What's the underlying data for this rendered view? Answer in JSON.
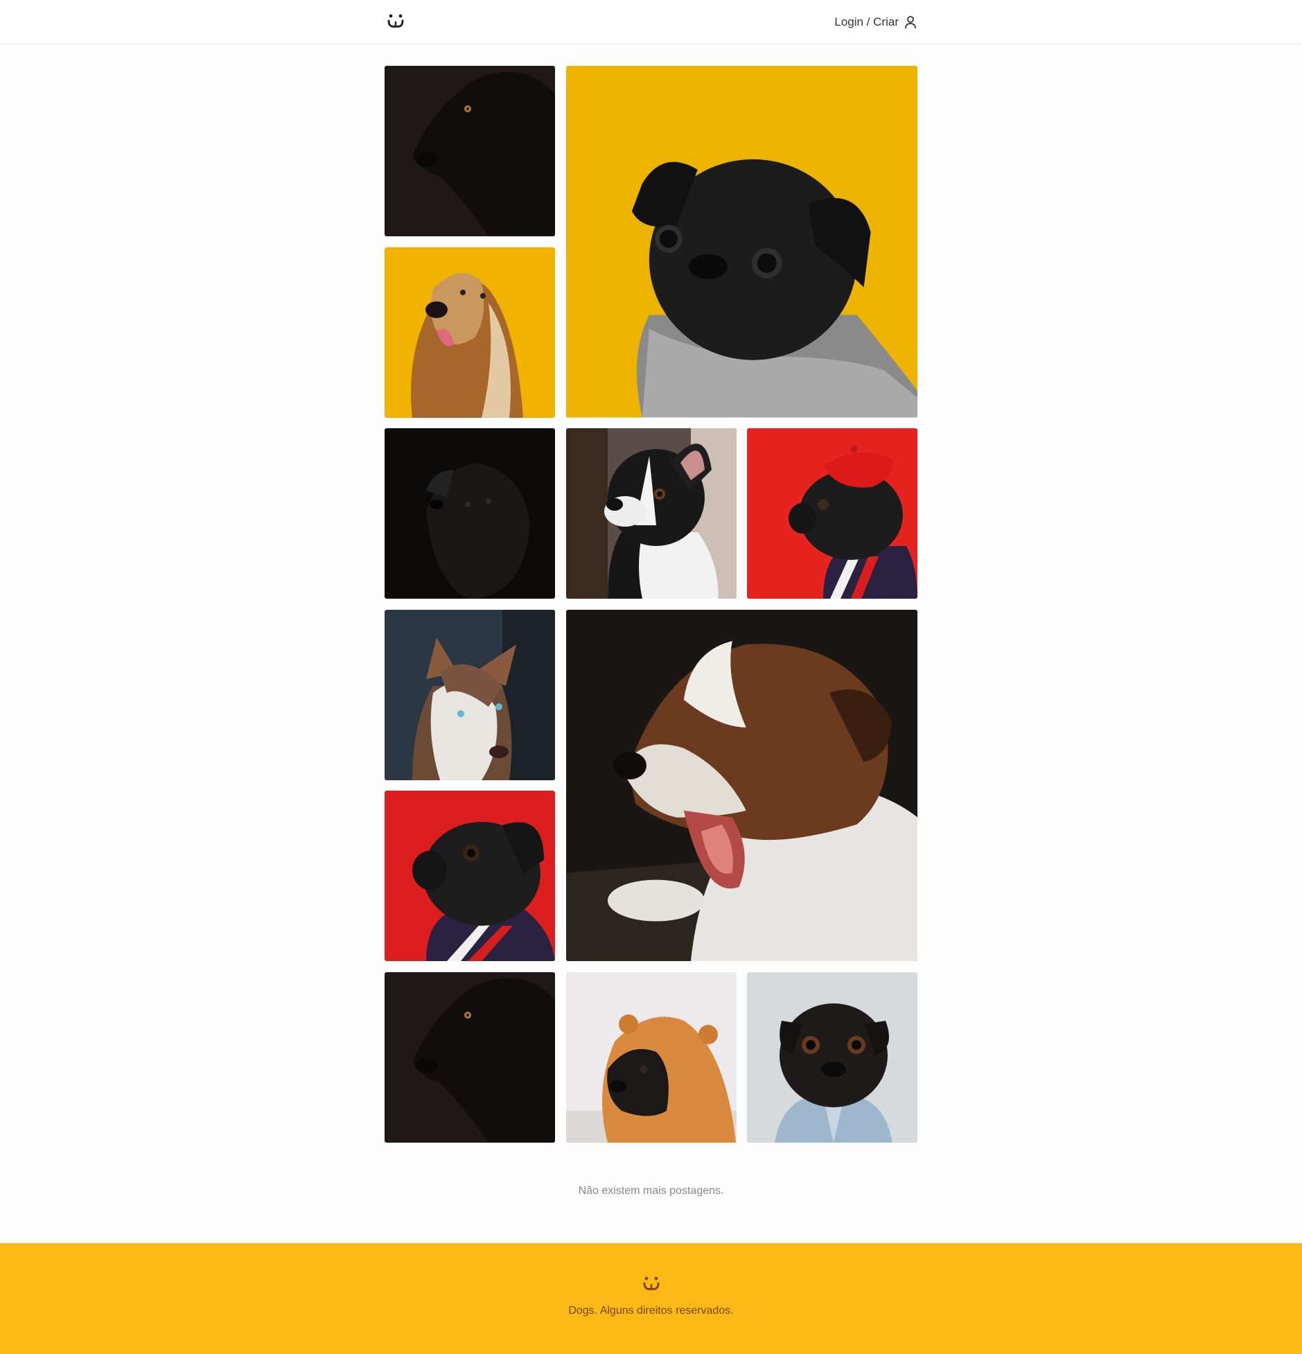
{
  "header": {
    "logo_icon": "dog-face-logo-icon",
    "login_label": "Login / Criar",
    "user_icon": "user-icon"
  },
  "feed": {
    "photos": [
      {
        "subject": "black dog in the dark",
        "bg": "#1f1718"
      },
      {
        "subject": "black pug in knit sweater on yellow",
        "bg": "#ecb300"
      },
      {
        "subject": "afghan hound on yellow",
        "bg": "#f2b300"
      },
      {
        "subject": "black dog looking up in the dark",
        "bg": "#0c0b09"
      },
      {
        "subject": "boston terrier",
        "bg": "#5a4c48"
      },
      {
        "subject": "pug in red beret on red",
        "bg": "#e5231f"
      },
      {
        "subject": "husky with blue eyes",
        "bg": "#2b3844"
      },
      {
        "subject": "yawning puppy",
        "bg": "#1a1613"
      },
      {
        "subject": "pug on red background",
        "bg": "#dd1e1f"
      },
      {
        "subject": "black dog in the dark",
        "bg": "#1f1718"
      },
      {
        "subject": "pug in orange hoodie",
        "bg": "#eceaea"
      },
      {
        "subject": "pug in denim jacket",
        "bg": "#d6dadd"
      }
    ],
    "end_message": "Não existem mais postagens."
  },
  "footer": {
    "logo_icon": "dog-face-logo-icon",
    "text": "Dogs. Alguns direitos reservados."
  },
  "colors": {
    "accent": "#fbb917",
    "footer_text": "#764701",
    "header_border": "#e4e4e4"
  }
}
